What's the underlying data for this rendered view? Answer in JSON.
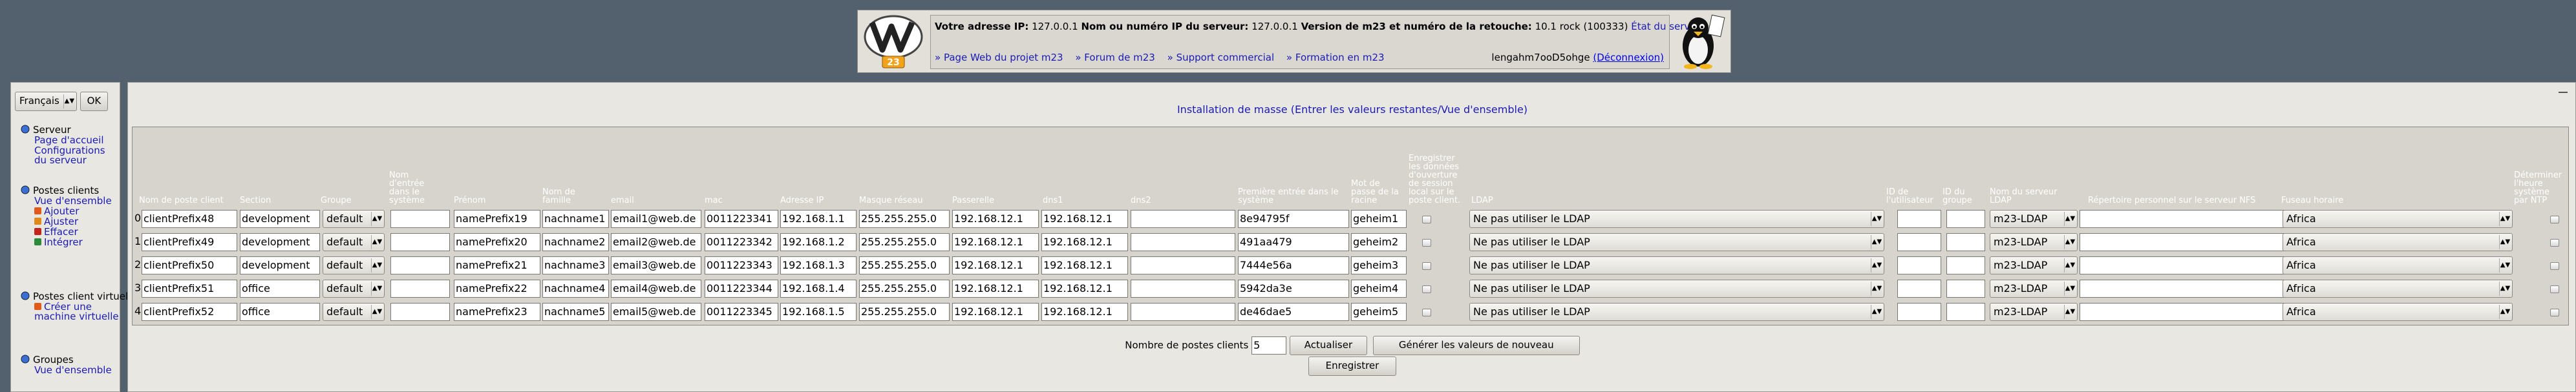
{
  "header": {
    "ip_label": "Votre adresse IP:",
    "ip_value": "127.0.0.1",
    "server_ip_label": "Nom ou numéro IP du serveur:",
    "server_ip_value": "127.0.0.1",
    "version_label": "Version de m23 et numéro de la retouche:",
    "version_value": "10.1 rock (100333)",
    "server_state_link": "État du serveur",
    "links": [
      "» Page Web du projet m23",
      "» Forum de m23",
      "» Support commercial",
      "» Formation en m23"
    ],
    "user": "lengahm7ooD5ohge",
    "logout": "(Déconnexion)"
  },
  "sidebar": {
    "language": "Français",
    "ok": "OK",
    "groups": [
      {
        "title": "Serveur",
        "icon": "server-icon",
        "items": [
          "Page d'accueil",
          "Configurations du serveur"
        ]
      },
      {
        "title": "Postes clients",
        "icon": "clients-icon",
        "items": [
          "Vue d'ensemble",
          "Ajouter",
          "Ajuster",
          "Effacer",
          "Intégrer"
        ]
      },
      {
        "title": "Postes client virtuels",
        "icon": "virtual-icon",
        "items": [
          "Créer une machine virtuelle"
        ]
      },
      {
        "title": "Groupes",
        "icon": "groups-icon",
        "items": [
          "Vue d'ensemble"
        ]
      }
    ]
  },
  "main": {
    "title": "Installation de masse (Entrer les valeurs restantes/Vue d'ensemble)",
    "columns": {
      "hostname": "Nom de poste client",
      "section": "Section",
      "group": "Groupe",
      "entry": "Nom d'entrée dans le système",
      "firstname": "Prénom",
      "lastname": "Nom de famille",
      "email": "email",
      "mac": "mac",
      "ip": "Adresse IP",
      "netmask": "Masque réseau",
      "gateway": "Passerelle",
      "dns1": "dns1",
      "dns2": "dns2",
      "firstlogin": "Première entrée dans le système",
      "rootpw": "Mot de passe de la racine",
      "savelogin": "Enregistrer les données d'ouverture de session local sur le poste client.",
      "ldap": "LDAP",
      "uid": "ID de l'utilisateur",
      "gid": "ID du groupe",
      "server": "Nom du serveur LDAP",
      "nfs": "Répertoire personnel sur le serveur NFS",
      "timezone": "Fuseau horaire",
      "ntp": "Déterminer l'heure système par NTP"
    },
    "rows": [
      {
        "num": "0",
        "hostname": "clientPrefix48",
        "section": "development",
        "group": "default",
        "firstname": "namePrefix19",
        "lastname": "nachname1",
        "email": "email1@web.de",
        "mac": "0011223341",
        "ip": "192.168.1.1",
        "netmask": "255.255.255.0",
        "gateway": "192.168.12.1",
        "dns1": "192.168.12.1",
        "login": "8e94795f",
        "rootpw": "geheim1",
        "ldap": "Ne pas utiliser le LDAP",
        "server": "m23-LDAP",
        "timezone": "Africa"
      },
      {
        "num": "1",
        "hostname": "clientPrefix49",
        "section": "development",
        "group": "default",
        "firstname": "namePrefix20",
        "lastname": "nachname2",
        "email": "email2@web.de",
        "mac": "0011223342",
        "ip": "192.168.1.2",
        "netmask": "255.255.255.0",
        "gateway": "192.168.12.1",
        "dns1": "192.168.12.1",
        "login": "491aa479",
        "rootpw": "geheim2",
        "ldap": "Ne pas utiliser le LDAP",
        "server": "m23-LDAP",
        "timezone": "Africa"
      },
      {
        "num": "2",
        "hostname": "clientPrefix50",
        "section": "development",
        "group": "default",
        "firstname": "namePrefix21",
        "lastname": "nachname3",
        "email": "email3@web.de",
        "mac": "0011223343",
        "ip": "192.168.1.3",
        "netmask": "255.255.255.0",
        "gateway": "192.168.12.1",
        "dns1": "192.168.12.1",
        "login": "7444e56a",
        "rootpw": "geheim3",
        "ldap": "Ne pas utiliser le LDAP",
        "server": "m23-LDAP",
        "timezone": "Africa"
      },
      {
        "num": "3",
        "hostname": "clientPrefix51",
        "section": "office",
        "group": "default",
        "firstname": "namePrefix22",
        "lastname": "nachname4",
        "email": "email4@web.de",
        "mac": "0011223344",
        "ip": "192.168.1.4",
        "netmask": "255.255.255.0",
        "gateway": "192.168.12.1",
        "dns1": "192.168.12.1",
        "login": "5942da3e",
        "rootpw": "geheim4",
        "ldap": "Ne pas utiliser le LDAP",
        "server": "m23-LDAP",
        "timezone": "Africa"
      },
      {
        "num": "4",
        "hostname": "clientPrefix52",
        "section": "office",
        "group": "default",
        "firstname": "namePrefix23",
        "lastname": "nachname5",
        "email": "email5@web.de",
        "mac": "0011223345",
        "ip": "192.168.1.5",
        "netmask": "255.255.255.0",
        "gateway": "192.168.12.1",
        "dns1": "192.168.12.1",
        "login": "de46dae5",
        "rootpw": "geheim5",
        "ldap": "Ne pas utiliser le LDAP",
        "server": "m23-LDAP",
        "timezone": "Africa"
      }
    ],
    "client_count_label": "Nombre de postes clients",
    "client_count_value": "5",
    "refresh_button": "Actualiser",
    "regenerate_button": "Générer les valeurs de nouveau",
    "save_button": "Enregistrer"
  },
  "colors": {
    "background": "#53606e",
    "panel": "#e9e7e1",
    "grid": "#d6d4cc",
    "link": "#1b1bb4",
    "header_text": "#ffffff"
  }
}
